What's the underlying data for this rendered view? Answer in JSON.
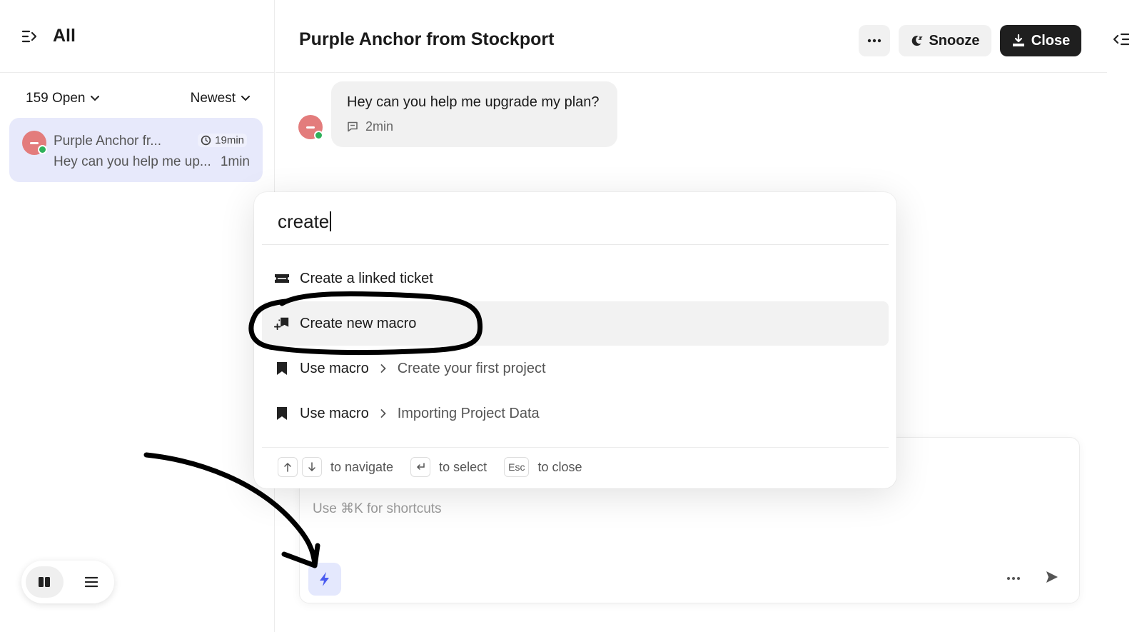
{
  "sidebar": {
    "title": "All",
    "filter_status": "159 Open",
    "filter_sort": "Newest",
    "conversations": [
      {
        "name": "Purple Anchor fr...",
        "badge": "19min",
        "preview": "Hey can you help me up...",
        "time": "1min"
      }
    ]
  },
  "header": {
    "title": "Purple Anchor from Stockport",
    "more_label": "...",
    "snooze_label": "Snooze",
    "close_label": "Close"
  },
  "message": {
    "text": "Hey can you help me upgrade my plan?",
    "time": "2min"
  },
  "composer": {
    "placeholder": "Use ⌘K for shortcuts"
  },
  "palette": {
    "query": "create",
    "items": [
      {
        "label": "Create a linked ticket",
        "icon": "ticket-icon"
      },
      {
        "label": "Create new macro",
        "icon": "add-macro-icon",
        "selected": true
      },
      {
        "label": "Use macro",
        "sub": "Create your first project",
        "icon": "bookmark-icon"
      },
      {
        "label": "Use macro",
        "sub": "Importing Project Data",
        "icon": "bookmark-icon"
      }
    ],
    "footer": {
      "navigate": "to navigate",
      "select": "to select",
      "esc_key": "Esc",
      "close": "to close"
    }
  },
  "colors": {
    "accent": "#4a5bf0",
    "selected_conversation": "#e7e9fb",
    "avatar": "#e37c7c",
    "online": "#2fb15b",
    "close_button": "#1f1f1f"
  }
}
